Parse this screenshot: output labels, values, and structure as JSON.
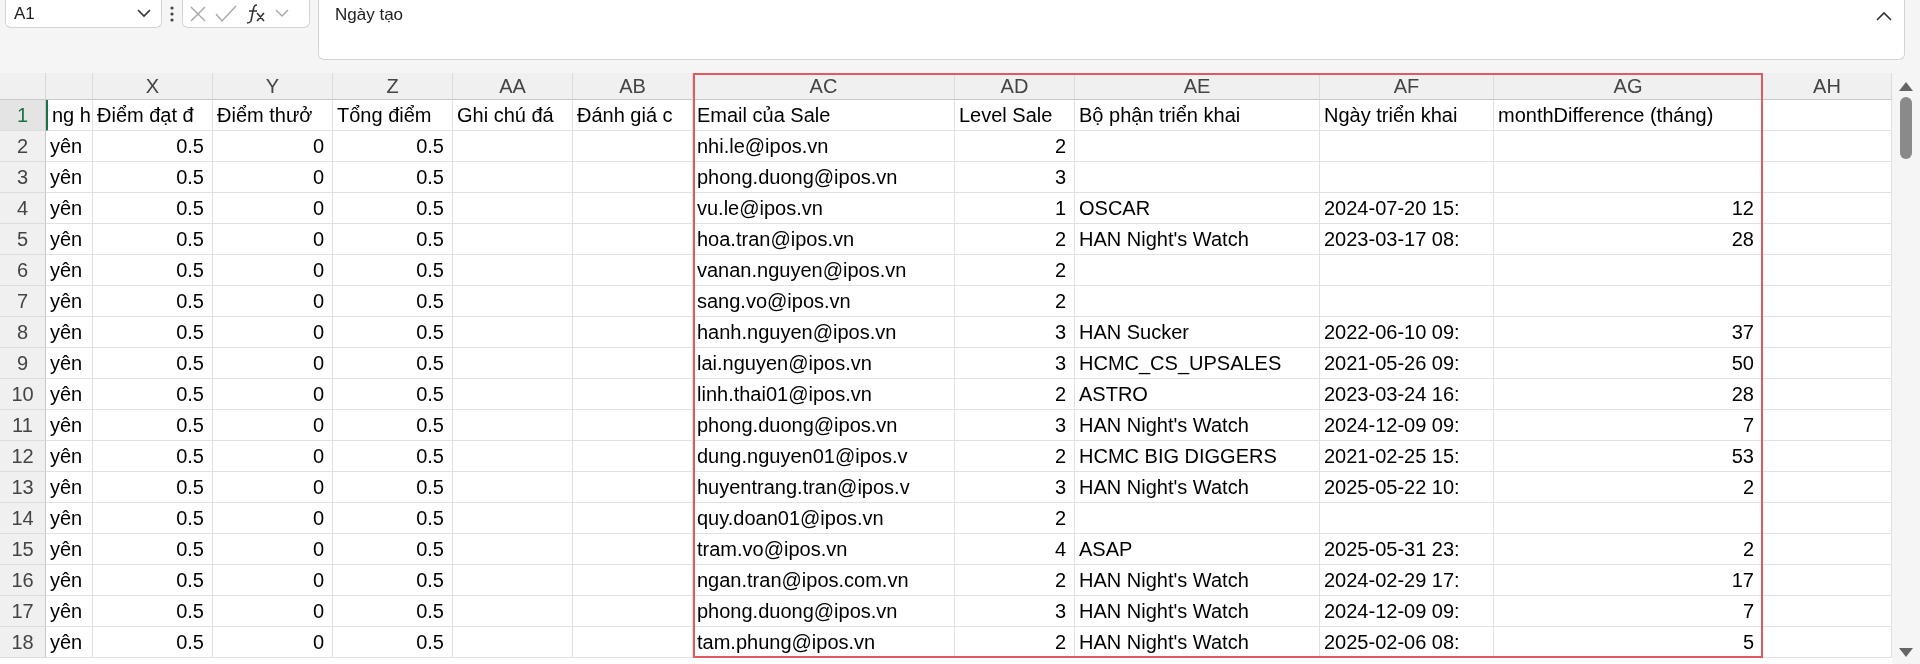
{
  "name_box": {
    "value": "A1"
  },
  "formula_bar": {
    "value": "Ngày tạo"
  },
  "columns": [
    {
      "kind": "text"
    },
    {
      "letter": "X",
      "kind": "number"
    },
    {
      "letter": "Y",
      "kind": "number"
    },
    {
      "letter": "Z",
      "kind": "number"
    },
    {
      "letter": "AA",
      "kind": "text"
    },
    {
      "letter": "AB",
      "kind": "text"
    },
    {
      "letter": "AC",
      "kind": "text"
    },
    {
      "letter": "AD",
      "kind": "number"
    },
    {
      "letter": "AE",
      "kind": "text"
    },
    {
      "letter": "AF",
      "kind": "text"
    },
    {
      "letter": "AG",
      "kind": "number"
    },
    {
      "letter": "AH",
      "kind": "text"
    }
  ],
  "header_row": {
    "number": "1",
    "selected": true,
    "cells": [
      "ng h",
      "Điểm đạt đ",
      "Điểm thưở",
      "Tổng điểm",
      "Ghi chú đá",
      "Đánh giá c",
      "Email của Sale",
      "Level Sale",
      "Bộ phận triển khai",
      "Ngày triển khai",
      "monthDifference (tháng)"
    ]
  },
  "rows": [
    {
      "number": "2",
      "selected": false,
      "cells": [
        "yên",
        "0.5",
        "0",
        "0.5",
        null,
        null,
        "nhi.le@ipos.vn",
        "2"
      ]
    },
    {
      "number": "3",
      "selected": false,
      "cells": [
        "yên",
        "0.5",
        "0",
        "0.5",
        null,
        null,
        "phong.duong@ipos.vn",
        "3"
      ]
    },
    {
      "number": "4",
      "selected": false,
      "cells": [
        "yên",
        "0.5",
        "0",
        "0.5",
        null,
        null,
        "vu.le@ipos.vn",
        "1",
        "OSCAR",
        "2024-07-20 15:",
        "12"
      ]
    },
    {
      "number": "5",
      "selected": false,
      "cells": [
        "yên",
        "0.5",
        "0",
        "0.5",
        null,
        null,
        "hoa.tran@ipos.vn",
        "2",
        "HAN Night's Watch",
        "2023-03-17 08:",
        "28"
      ]
    },
    {
      "number": "6",
      "selected": false,
      "cells": [
        "yên",
        "0.5",
        "0",
        "0.5",
        null,
        null,
        "vanan.nguyen@ipos.vn",
        "2"
      ]
    },
    {
      "number": "7",
      "selected": false,
      "cells": [
        "yên",
        "0.5",
        "0",
        "0.5",
        null,
        null,
        "sang.vo@ipos.vn",
        "2"
      ]
    },
    {
      "number": "8",
      "selected": false,
      "cells": [
        "yên",
        "0.5",
        "0",
        "0.5",
        null,
        null,
        "hanh.nguyen@ipos.vn",
        "3",
        "HAN Sucker",
        "2022-06-10 09:",
        "37"
      ]
    },
    {
      "number": "9",
      "selected": false,
      "cells": [
        "yên",
        "0.5",
        "0",
        "0.5",
        null,
        null,
        "lai.nguyen@ipos.vn",
        "3",
        "HCMC_CS_UPSALES",
        "2021-05-26 09:",
        "50"
      ]
    },
    {
      "number": "10",
      "selected": false,
      "cells": [
        "yên",
        "0.5",
        "0",
        "0.5",
        null,
        null,
        "linh.thai01@ipos.vn",
        "2",
        "ASTRO",
        "2023-03-24 16:",
        "28"
      ]
    },
    {
      "number": "11",
      "selected": false,
      "cells": [
        "yên",
        "0.5",
        "0",
        "0.5",
        null,
        null,
        "phong.duong@ipos.vn",
        "3",
        "HAN Night's Watch",
        "2024-12-09 09:",
        "7"
      ]
    },
    {
      "number": "12",
      "selected": false,
      "cells": [
        "yên",
        "0.5",
        "0",
        "0.5",
        null,
        null,
        "dung.nguyen01@ipos.v",
        "2",
        "HCMC BIG DIGGERS",
        "2021-02-25 15:",
        "53"
      ]
    },
    {
      "number": "13",
      "selected": false,
      "cells": [
        "yên",
        "0.5",
        "0",
        "0.5",
        null,
        null,
        "huyentrang.tran@ipos.v",
        "3",
        "HAN Night's Watch",
        "2025-05-22 10:",
        "2"
      ]
    },
    {
      "number": "14",
      "selected": false,
      "cells": [
        "yên",
        "0.5",
        "0",
        "0.5",
        null,
        null,
        "quy.doan01@ipos.vn",
        "2"
      ]
    },
    {
      "number": "15",
      "selected": false,
      "cells": [
        "yên",
        "0.5",
        "0",
        "0.5",
        null,
        null,
        "tram.vo@ipos.vn",
        "4",
        "ASAP",
        "2025-05-31 23:",
        "2"
      ]
    },
    {
      "number": "16",
      "selected": false,
      "cells": [
        "yên",
        "0.5",
        "0",
        "0.5",
        null,
        null,
        "ngan.tran@ipos.com.vn",
        "2",
        "HAN Night's Watch",
        "2024-02-29 17:",
        "17"
      ]
    },
    {
      "number": "17",
      "selected": false,
      "cells": [
        "yên",
        "0.5",
        "0",
        "0.5",
        null,
        null,
        "phong.duong@ipos.vn",
        "3",
        "HAN Night's Watch",
        "2024-12-09 09:",
        "7"
      ]
    },
    {
      "number": "18",
      "selected": false,
      "cells": [
        "yên",
        "0.5",
        "0",
        "0.5",
        null,
        null,
        "tam.phung@ipos.vn",
        "2",
        "HAN Night's Watch",
        "2025-02-06 08:",
        "5"
      ]
    }
  ]
}
